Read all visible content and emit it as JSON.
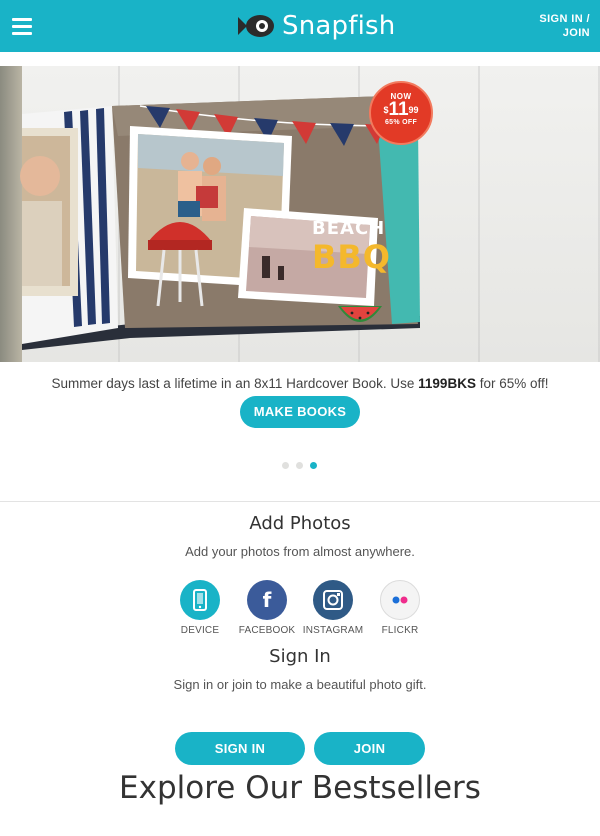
{
  "header": {
    "brand": "Snapfish",
    "account_line1": "SIGN IN /",
    "account_line2": "JOIN",
    "bg_color": "#19b3c7"
  },
  "hero": {
    "badge_now": "NOW",
    "badge_price_dollar": "$",
    "badge_price": "11",
    "badge_price_cents": "99",
    "badge_off": "65% OFF",
    "book_title_line1": "BEACH",
    "book_title_line2": "BBQ"
  },
  "promo": {
    "text_before": "Summer days last a lifetime in an 8x11 Hardcover Book. Use ",
    "code": "1199BKS",
    "text_after": " for 65% off!",
    "button": "MAKE BOOKS"
  },
  "carousel": {
    "slides": 3,
    "active_index": 2
  },
  "add_photos": {
    "title": "Add Photos",
    "subtitle": "Add your photos from almost anywhere.",
    "sources": [
      {
        "label": "DEVICE",
        "icon": "phone-icon",
        "color": "#19b3c7"
      },
      {
        "label": "FACEBOOK",
        "icon": "facebook-icon",
        "color": "#3b5b9a"
      },
      {
        "label": "INSTAGRAM",
        "icon": "instagram-icon",
        "color": "#2f5a86"
      },
      {
        "label": "FLICKR",
        "icon": "flickr-icon",
        "color": "#f2f2f2"
      }
    ]
  },
  "sign_in": {
    "title": "Sign In",
    "subtitle": "Sign in or join to make a beautiful photo gift.",
    "signin_button": "SIGN IN",
    "join_button": "JOIN"
  },
  "bestsellers": {
    "title": "Explore Our Bestsellers"
  }
}
